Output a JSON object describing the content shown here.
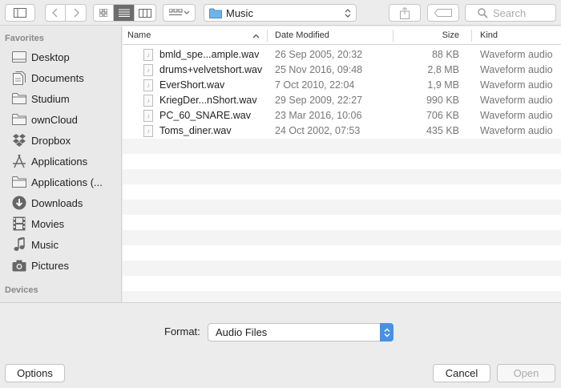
{
  "toolbar": {
    "location": "Music",
    "search_placeholder": "Search"
  },
  "sidebar": {
    "favorites_header": "Favorites",
    "devices_header": "Devices",
    "items": [
      {
        "label": "Desktop"
      },
      {
        "label": "Documents"
      },
      {
        "label": "Studium"
      },
      {
        "label": "ownCloud"
      },
      {
        "label": "Dropbox"
      },
      {
        "label": "Applications"
      },
      {
        "label": "Applications (..."
      },
      {
        "label": "Downloads"
      },
      {
        "label": "Movies"
      },
      {
        "label": "Music"
      },
      {
        "label": "Pictures"
      }
    ]
  },
  "table": {
    "columns": {
      "name": "Name",
      "date": "Date Modified",
      "size": "Size",
      "kind": "Kind"
    },
    "rows": [
      {
        "name": "bmld_spe...ample.wav",
        "date": "26 Sep 2005, 20:32",
        "size": "88 KB",
        "kind": "Waveform audio"
      },
      {
        "name": "drums+velvetshort.wav",
        "date": "25 Nov 2016, 09:48",
        "size": "2,8 MB",
        "kind": "Waveform audio"
      },
      {
        "name": "EverShort.wav",
        "date": "7 Oct 2010, 22:04",
        "size": "1,9 MB",
        "kind": "Waveform audio"
      },
      {
        "name": "KriegDer...nShort.wav",
        "date": "29 Sep 2009, 22:27",
        "size": "990 KB",
        "kind": "Waveform audio"
      },
      {
        "name": "PC_60_SNARE.wav",
        "date": "23 Mar 2016, 10:06",
        "size": "706 KB",
        "kind": "Waveform audio"
      },
      {
        "name": "Toms_diner.wav",
        "date": "24 Oct 2002, 07:53",
        "size": "435 KB",
        "kind": "Waveform audio"
      }
    ]
  },
  "format": {
    "label": "Format:",
    "value": "Audio Files"
  },
  "buttons": {
    "options": "Options",
    "cancel": "Cancel",
    "open": "Open"
  },
  "colors": {
    "accent": "#4a90e2",
    "folder": "#6fb3e8"
  }
}
